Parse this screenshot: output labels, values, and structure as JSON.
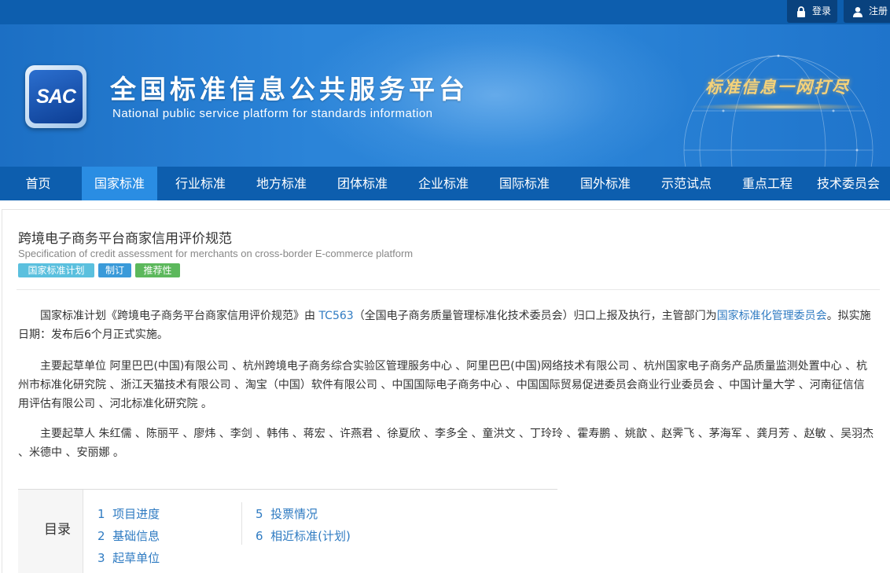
{
  "topbar": {
    "login_label": "登录",
    "register_label": "注册"
  },
  "header": {
    "logo_text": "SAC",
    "site_title": "全国标准信息公共服务平台",
    "site_subtitle": "National public service platform  for standards information",
    "slogan": "标准信息一网打尽"
  },
  "nav": {
    "items": [
      {
        "label": "首页"
      },
      {
        "label": "国家标准",
        "active": true
      },
      {
        "label": "行业标准"
      },
      {
        "label": "地方标准"
      },
      {
        "label": "团体标准"
      },
      {
        "label": "企业标准"
      },
      {
        "label": "国际标准"
      },
      {
        "label": "国外标准"
      },
      {
        "label": "示范试点"
      },
      {
        "label": "重点工程"
      },
      {
        "label": "技术委员会"
      }
    ]
  },
  "standard": {
    "title_cn": "跨境电子商务平台商家信用评价规范",
    "title_en": "Specification of credit assessment for merchants on cross-border E-commerce platform",
    "tags": [
      {
        "label": "国家标准计划",
        "color": "#5bc0de"
      },
      {
        "label": "制订",
        "color": "#3a9ad9"
      },
      {
        "label": "推荐性",
        "color": "#5cb85c"
      }
    ]
  },
  "description": {
    "p1_a": "国家标准计划《跨境电子商务平台商家信用评价规范》由 ",
    "p1_link1": "TC563",
    "p1_b": "（全国电子商务质量管理标准化技术委员会）归口上报及执行，主管部门为",
    "p1_link2": "国家标准化管理委员会",
    "p1_c": "。拟实施日期：发布后6个月正式实施。",
    "p2": "主要起草单位 阿里巴巴(中国)有限公司 、杭州跨境电子商务综合实验区管理服务中心 、阿里巴巴(中国)网络技术有限公司 、杭州国家电子商务产品质量监测处置中心 、杭州市标准化研究院 、浙江天猫技术有限公司 、淘宝（中国）软件有限公司 、中国国际电子商务中心 、中国国际贸易促进委员会商业行业委员会 、中国计量大学 、河南征信信用评估有限公司 、河北标准化研究院 。",
    "p3": "主要起草人 朱红儒 、陈丽平 、廖炜 、李剑 、韩伟 、蒋宏 、许燕君 、徐夏欣 、李多全 、童洪文 、丁玲玲 、霍寿鹏 、姚歆 、赵霁飞 、茅海军 、龚月芳 、赵敏 、吴羽杰 、米德中 、安丽娜 。"
  },
  "toc": {
    "label": "目录",
    "entries": [
      {
        "num": "1",
        "text": "项目进度"
      },
      {
        "num": "2",
        "text": "基础信息"
      },
      {
        "num": "3",
        "text": "起草单位"
      },
      {
        "num": "5",
        "text": "投票情况"
      },
      {
        "num": "6",
        "text": "相近标准(计划)"
      }
    ]
  }
}
